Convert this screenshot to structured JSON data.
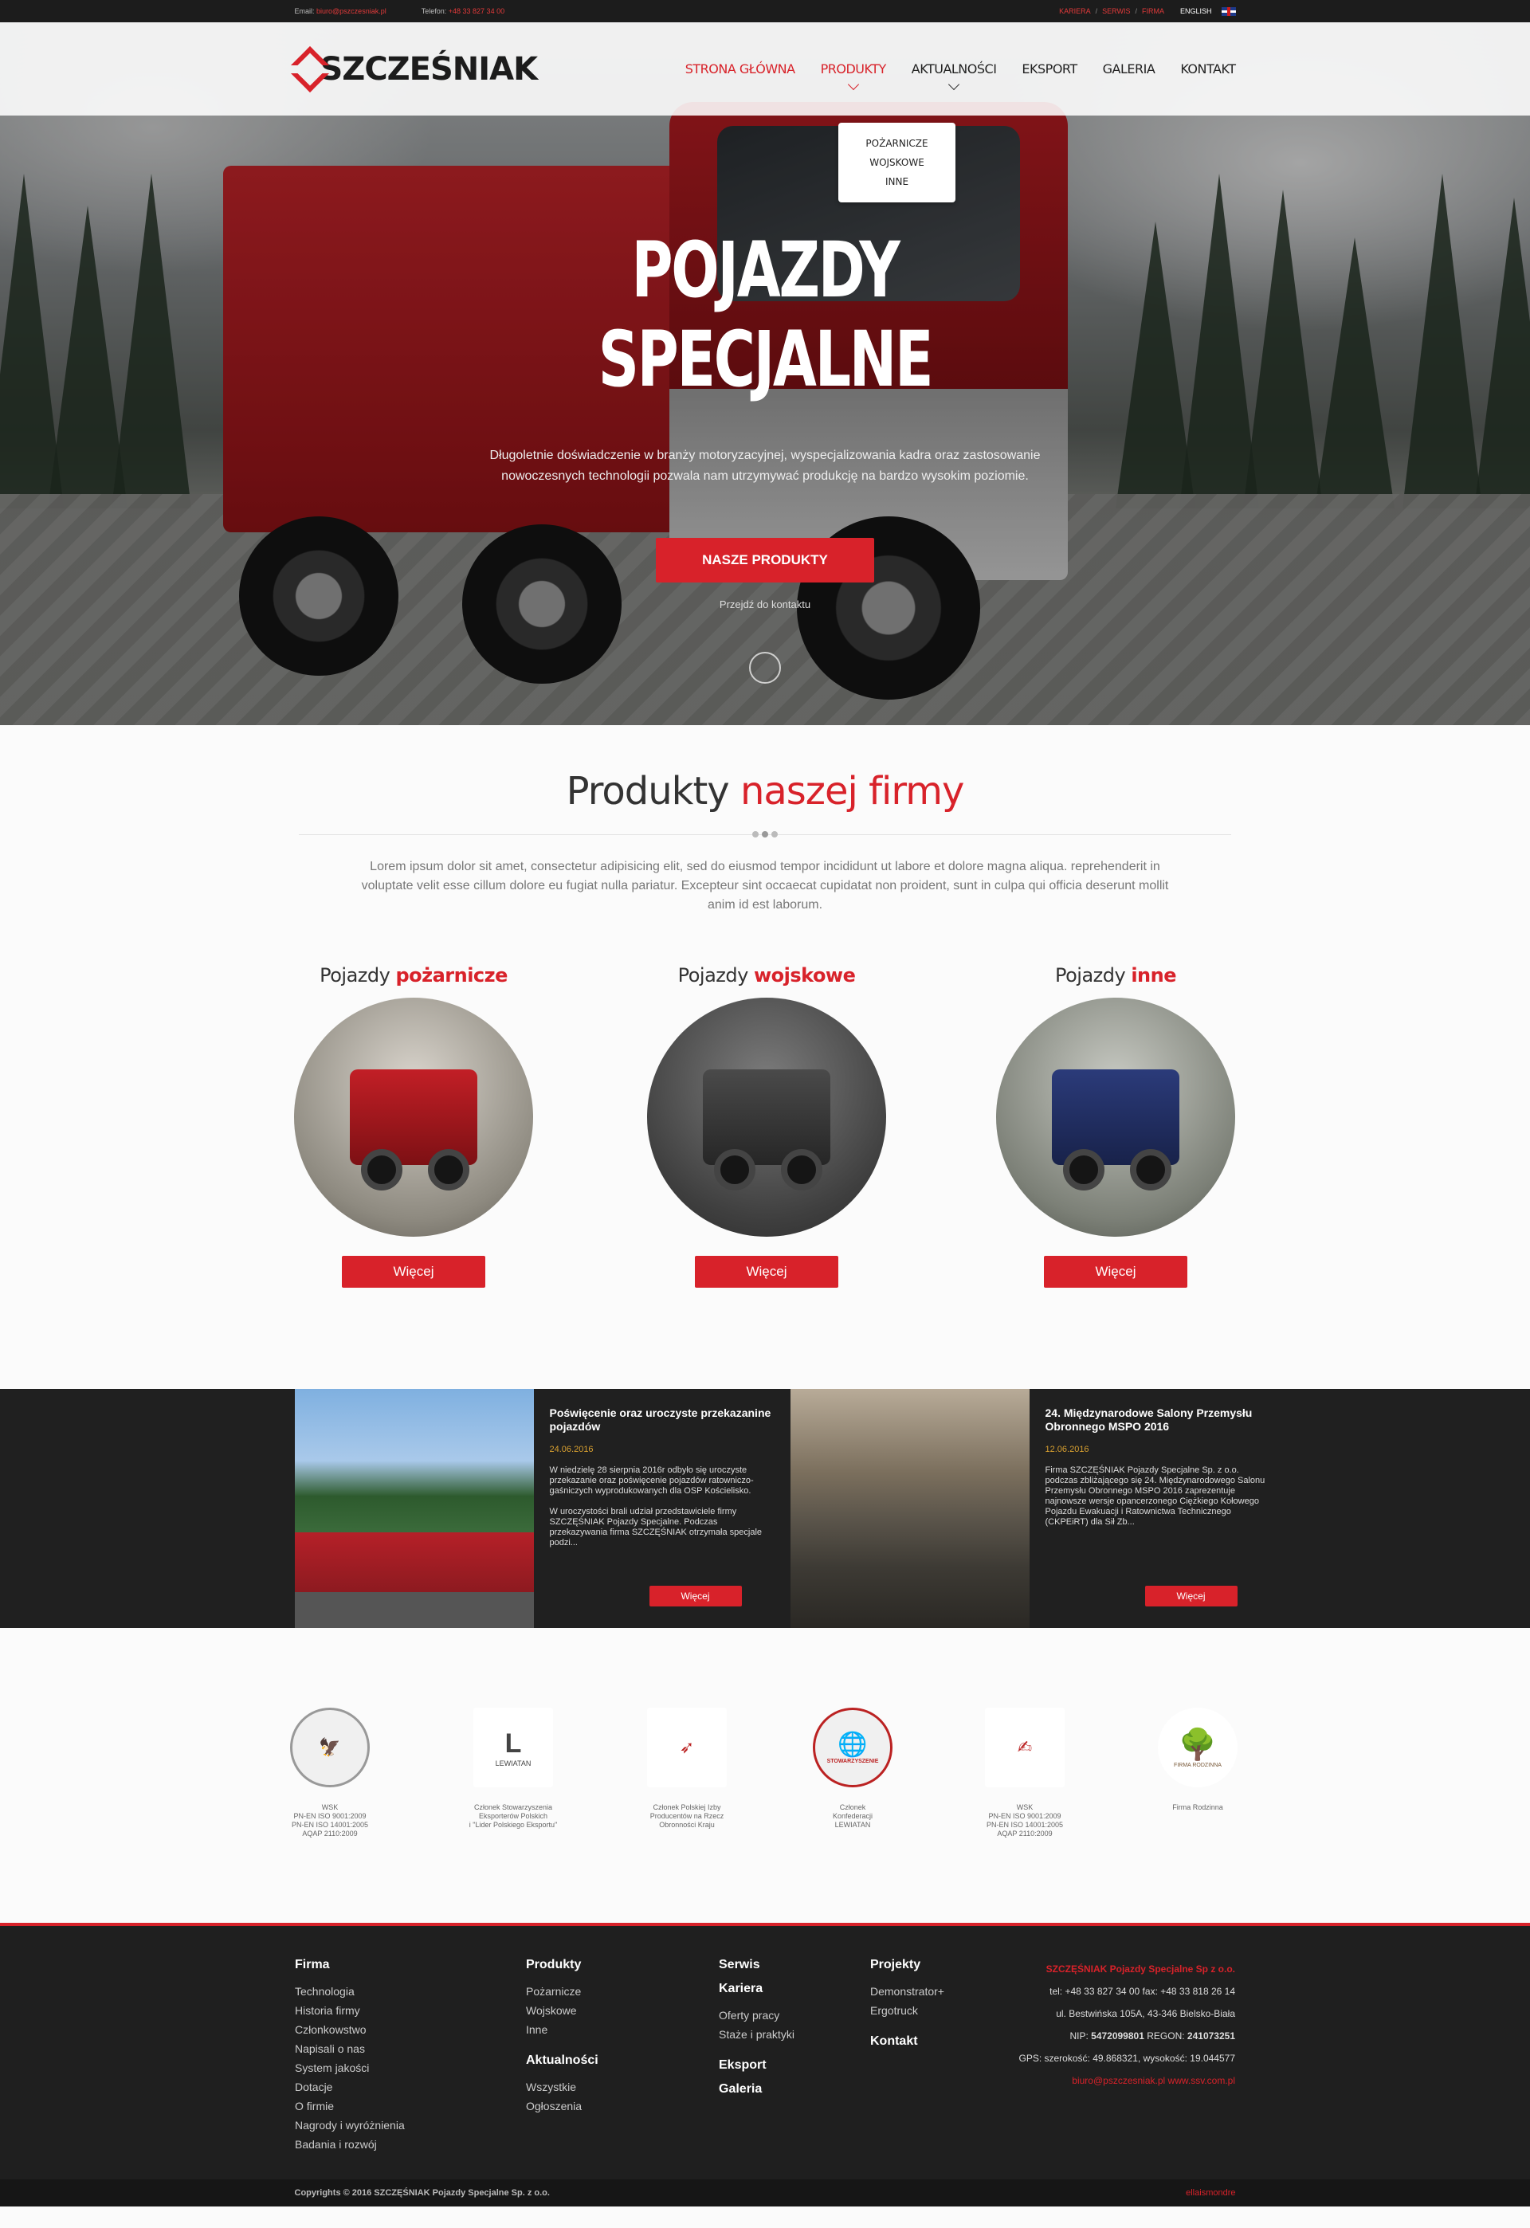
{
  "topbar": {
    "email_label": "Email:",
    "email": "biuro@pszczesniak.pl",
    "phone_label": "Telefon:",
    "phone": "+48 33 827 34 00",
    "links": [
      "KARIERA",
      "SERWIS",
      "FIRMA"
    ],
    "language": "ENGLISH"
  },
  "nav": {
    "logo_text": "SZCZEŚNIAK",
    "items": [
      "STRONA GŁÓWNA",
      "PRODUKTY",
      "AKTUALNOŚCI",
      "EKSPORT",
      "GALERIA",
      "KONTAKT"
    ],
    "dropdown": [
      "POŻARNICZE",
      "WOJSKOWE",
      "INNE"
    ]
  },
  "hero": {
    "title_line1": "POJAZDY",
    "title_line2": "SPECJALNE",
    "subtitle": "Długoletnie doświadczenie w branży motoryzacyjnej, wyspecjalizowania kadra oraz zastosowanie nowoczesnych technologii pozwala nam utrzymywać produkcję na bardzo wysokim poziomie.",
    "button": "NASZE PRODUKTY",
    "link": "Przejdź do kontaktu"
  },
  "products": {
    "title_main": "Produkty",
    "title_accent": "naszej firmy",
    "lead": "Lorem ipsum dolor sit amet, consectetur adipisicing elit, sed do eiusmod tempor incididunt ut labore et dolore magna aliqua. reprehenderit in voluptate velit esse cillum dolore eu fugiat nulla pariatur. Excepteur sint occaecat cupidatat non proident, sunt in culpa qui officia deserunt mollit anim id est laborum.",
    "cards": [
      {
        "prefix": "Pojazdy",
        "accent": "pożarnicze",
        "button": "Więcej"
      },
      {
        "prefix": "Pojazdy",
        "accent": "wojskowe",
        "button": "Więcej"
      },
      {
        "prefix": "Pojazdy",
        "accent": "inne",
        "button": "Więcej"
      }
    ]
  },
  "news": [
    {
      "title": "Poświęcenie oraz uroczyste przekazanine pojazdów",
      "date": "24.06.2016",
      "excerpt": "W niedzielę 28 sierpnia 2016r odbyło się uroczyste przekazanie oraz poświęcenie pojazdów ratowniczo-gaśniczych wyprodukowanych dla OSP Kościelisko.\n\nW uroczystości brali udział przedstawiciele firmy SZCZĘŚNIAK Pojazdy Specjalne. Podczas przekazywania firma SZCZĘŚNIAK otrzymała specjale podzi...",
      "button": "Więcej"
    },
    {
      "title": "24. Międzynarodowe Salony Przemysłu Obronnego MSPO 2016",
      "date": "12.06.2016",
      "excerpt": "Firma SZCZĘŚNIAK Pojazdy Specjalne Sp. z o.o. podczas zbliżającego się 24. Międzynarodowego Salonu Przemysłu Obronnego MSPO 2016 zaprezentuje najnowsze wersje opancerzonego Ciężkiego Kołowego Pojazdu Ewakuacji i Ratownictwa Technicznego (CKPEiRT) dla Sił Zb...",
      "button": "Więcej"
    }
  ],
  "certs": [
    {
      "caption": "WSK\nPN-EN ISO 9001:2009\nPN-EN ISO 14001:2005\nAQAP 2110:2009"
    },
    {
      "caption": "Członek Stowarzyszenia\nEksporterów Polskich\ni \"Lider Polskiego Eksportu\"",
      "logo_text": "LEWIATAN"
    },
    {
      "caption": "Członek Polskiej Izby\nProducentów na Rzecz\nObronności Kraju"
    },
    {
      "caption": "Członek\nKonfederacji\nLEWIATAN",
      "logo_text": "STOWARZYSZENIE"
    },
    {
      "caption": "WSK\nPN-EN ISO 9001:2009\nPN-EN ISO 14001:2005\nAQAP 2110:2009"
    },
    {
      "caption": "Firma Rodzinna",
      "logo_text": "FIRMA RODZINNA"
    }
  ],
  "footer": {
    "col1": {
      "heading": "Firma",
      "links": [
        "Technologia",
        "Historia firmy",
        "Członkowstwo",
        "Napisali o nas",
        "System jakości",
        "Dotacje",
        "O firmie",
        "Nagrody i wyróżnienia",
        "Badania i rozwój"
      ]
    },
    "col2": {
      "heading": "Produkty",
      "links": [
        "Pożarnicze",
        "Wojskowe",
        "Inne"
      ],
      "heading2": "Aktualności",
      "links2": [
        "Wszystkie",
        "Ogłoszenia"
      ]
    },
    "col3": {
      "heading": "Serwis",
      "heading2": "Kariera",
      "links2": [
        "Oferty pracy",
        "Staże i praktyki"
      ],
      "heading3": "Eksport",
      "heading4": "Galeria"
    },
    "col4": {
      "heading": "Projekty",
      "links": [
        "Demonstrator+",
        "Ergotruck"
      ],
      "heading2": "Kontakt"
    },
    "contact": {
      "company": "SZCZĘŚNIAK Pojazdy Specjalne Sp z o.o.",
      "phone": "tel: +48 33 827 34 00 fax: +48 33 818 26 14",
      "address": "ul. Bestwińska 105A, 43-346 Bielsko-Biała",
      "nip_label": "NIP:",
      "nip": "5472099801",
      "regon_label": "REGON:",
      "regon": "241073251",
      "gps": "GPS: szerokość: 49.868321, wysokość: 19.044577",
      "email_web": "biuro@pszczesniak.pl www.ssv.com.pl"
    },
    "copyright": "Copyrights © 2016 SZCZĘŚNIAK Pojazdy Specjalne Sp. z o.o.",
    "credit": "ellaismondre"
  }
}
